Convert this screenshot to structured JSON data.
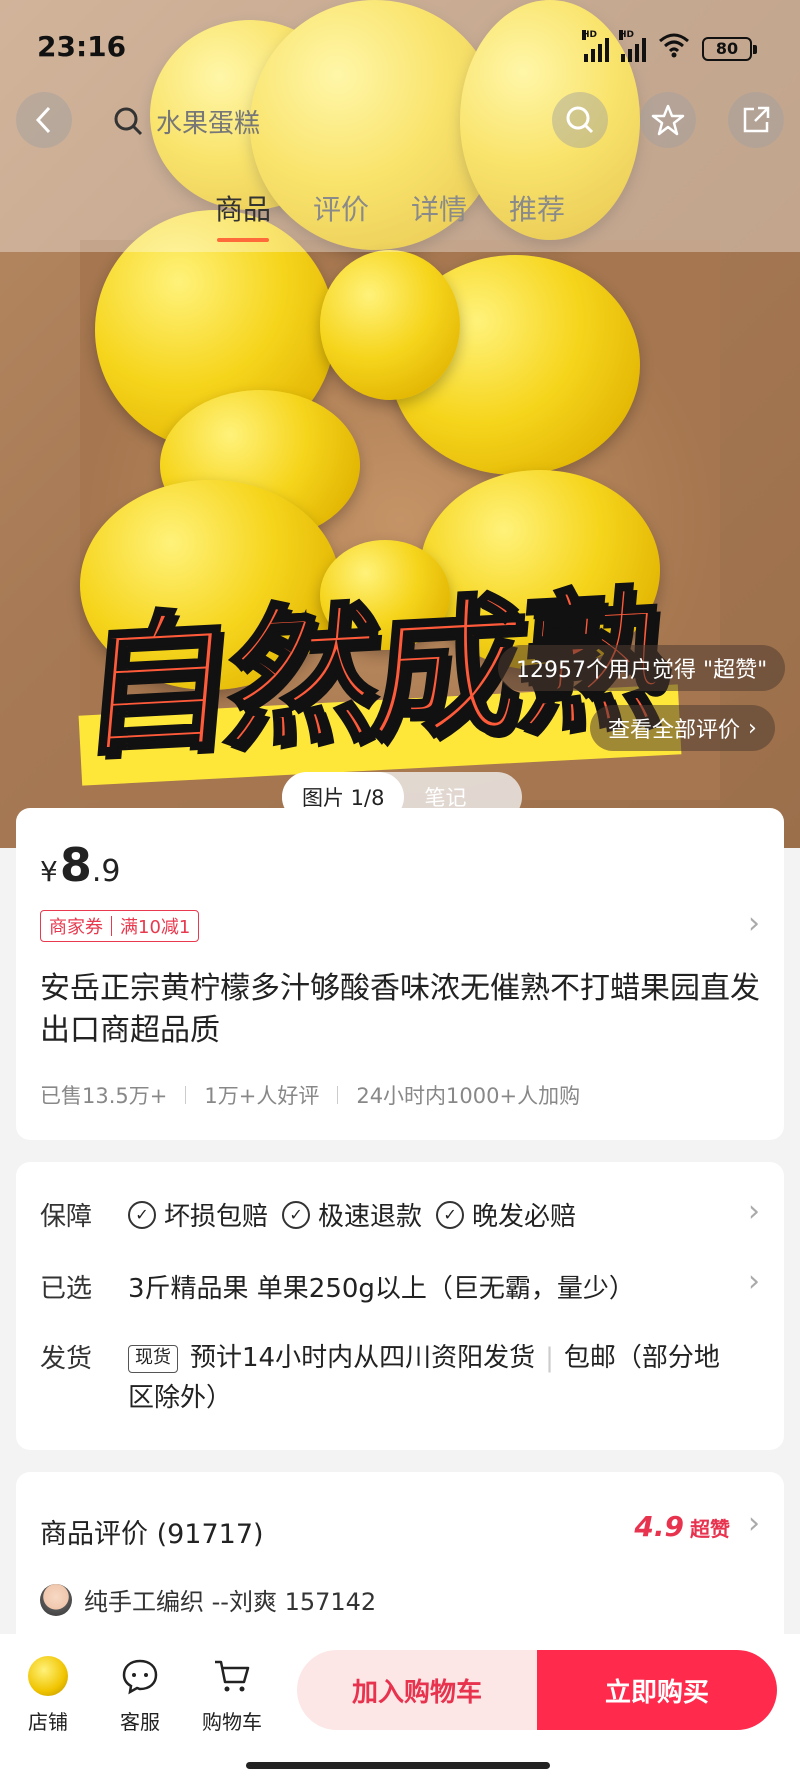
{
  "status_bar": {
    "time": "23:16",
    "battery": "80"
  },
  "nav": {
    "search_placeholder": "水果蛋糕",
    "tabs": [
      "商品",
      "评价",
      "详情",
      "推荐"
    ]
  },
  "hero": {
    "big_text": "自然成熟",
    "praise_pill": "12957个用户觉得 \"超赞\"",
    "all_reviews_pill": "查看全部评价",
    "image_tabs": [
      "图片 1/8",
      "笔记"
    ]
  },
  "product": {
    "price_symbol": "¥",
    "price_int": "8",
    "price_dec": ".9",
    "coupon_label": "商家券",
    "coupon_value": "满10减1",
    "title": "安岳正宗黄柠檬多汁够酸香味浓无催熟不打蜡果园直发出口商超品质",
    "stats": [
      "已售13.5万+",
      "1万+人好评",
      "24小时内1000+人加购"
    ]
  },
  "service": {
    "guarantee_label": "保障",
    "guarantees": [
      "坏损包赔",
      "极速退款",
      "晚发必赔"
    ],
    "selected_label": "已选",
    "selected_value": "3斤精品果 单果250g以上（巨无霸，量少）",
    "shipping_label": "发货",
    "shipping_tag": "现货",
    "shipping_value": "预计14小时内从四川资阳发货",
    "shipping_extra": "包邮（部分地区除外）"
  },
  "reviews": {
    "title": "商品评价 (91717)",
    "score": "4.9",
    "score_label": "超赞",
    "first_reviewer": "纯手工编织 --刘爽 157142"
  },
  "bottom_bar": {
    "shop": "店铺",
    "service": "客服",
    "cart": "购物车",
    "add_to_cart": "加入购物车",
    "buy_now": "立即购买"
  },
  "colors": {
    "accent": "#ff2a4c",
    "price_red": "#e8334f",
    "tab_indicator": "#ff6a3a"
  }
}
